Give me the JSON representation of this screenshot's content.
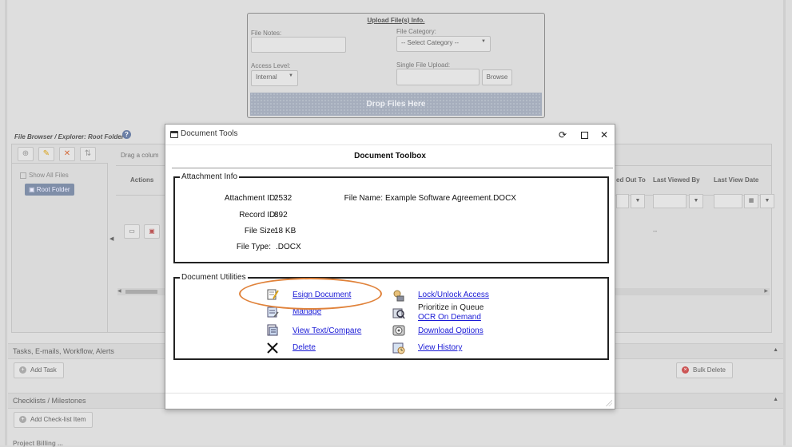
{
  "upload": {
    "title": "Upload File(s) Info.",
    "file_notes_label": "File Notes:",
    "file_category_label": "File Category:",
    "file_category_value": "-- Select Category --",
    "access_level_label": "Access Level:",
    "access_level_value": "Internal",
    "single_upload_label": "Single File Upload:",
    "browse_label": "Browse",
    "drop_label": "Drop Files Here"
  },
  "file_browser": {
    "label": "File Browser / Explorer:  Root Folder",
    "help": "?",
    "show_all": "Show All Files",
    "root_folder": "Root Folder",
    "drag_hint": "Drag a colum",
    "columns": {
      "actions": "Actions",
      "checked_out_to": "ed Out To",
      "last_viewed_by": "Last Viewed By",
      "last_view_date": "Last View Date"
    },
    "dash": "--"
  },
  "sections": {
    "tasks_title": "Tasks, E-mails, Workflow, Alerts",
    "add_task": "Add Task",
    "bulk_delete": "Bulk Delete",
    "checklists_title": "Checklists / Milestones",
    "add_checklist": "Add Check-list Item",
    "bottom_cut": "Project Billing ..."
  },
  "modal": {
    "window_title": "Document Tools",
    "heading": "Document Toolbox",
    "attachment_legend": "Attachment Info",
    "attachment_id_label": "Attachment ID:",
    "attachment_id": "2532",
    "record_id_label": "Record ID:",
    "record_id": "892",
    "file_size_label": "File Size:",
    "file_size": "18 KB",
    "file_type_label": "File Type:",
    "file_type": ".DOCX",
    "file_name_label": "File Name:",
    "file_name": "Example Software Agreement.DOCX",
    "utilities_legend": "Document Utilities",
    "utilities": {
      "esign": "Esign Document",
      "manage": "Manage",
      "view_text": "View Text/Compare",
      "delete": "Delete",
      "lock_unlock": "Lock/Unlock Access",
      "prioritize": "Prioritize in Queue",
      "ocr": "OCR On Demand",
      "download": "Download Options",
      "history": "View History"
    }
  },
  "colors": {
    "link": "#1a1ad6",
    "highlight": "#e0823a",
    "drop_zone": "#a6aebd"
  }
}
